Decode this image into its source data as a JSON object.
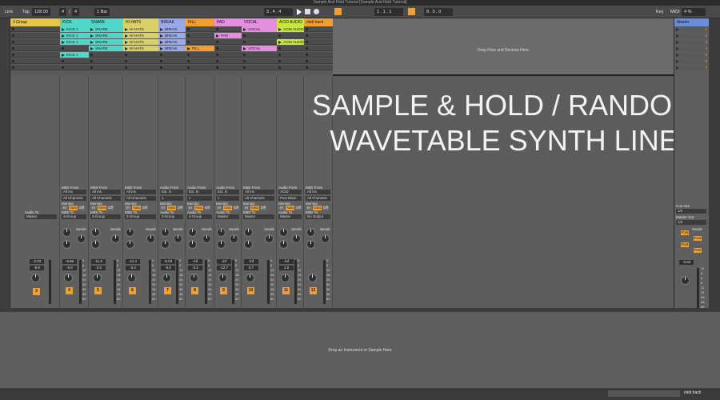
{
  "window_title": "Sample And Hold Tutorial  [Sample And Hold Tutorial]",
  "transport": {
    "link": "Link",
    "tap": "Tap",
    "tempo": "128.00",
    "sig_num": "4",
    "sig_den": "4",
    "quantize": "1 Bar",
    "position": "3 .  4 .  4",
    "loop_start": "1 .  1 .  1",
    "loop_len": "8 .  0 .  0",
    "key": "Key",
    "midi": "MIDI",
    "cpu": "4 %"
  },
  "tracks": [
    {
      "name": "3 Group",
      "color": "#e6c64a",
      "clips": []
    },
    {
      "name": "KICK",
      "color": "#52d6c8",
      "clips": [
        "KICK 1",
        "KICK 1",
        "KICK 1",
        "",
        "KICK 1"
      ]
    },
    {
      "name": "SNARE",
      "color": "#52d6c8",
      "clips": [
        "SNARE",
        "SNARE",
        "SNARE",
        "SNARE",
        ""
      ]
    },
    {
      "name": "HI HATS",
      "color": "#d9d06a",
      "clips": [
        "HI HATS",
        "HI HATS",
        "HI HATS",
        "HI HATS",
        ""
      ]
    },
    {
      "name": "BREAK",
      "color": "#9aa8e8",
      "clips": [
        "BREAK",
        "BREAK",
        "BREAK",
        "BREAK",
        ""
      ]
    },
    {
      "name": "FILL",
      "color": "#f0a030",
      "clips": [
        "",
        "",
        "",
        "FILL",
        ""
      ]
    },
    {
      "name": "PAD",
      "color": "#e48ee0",
      "clips": [
        "",
        "PAD",
        "",
        "",
        ""
      ]
    },
    {
      "name": "VOCAL",
      "color": "#e48ee0",
      "clips": [
        "VOCAL",
        "",
        "",
        "VOCAL",
        ""
      ]
    },
    {
      "name": "ACID AUDIO",
      "color": "#c8e640",
      "clips": [
        "ACID AUDIO",
        "",
        "ACID AUDIO",
        "",
        ""
      ]
    },
    {
      "name": "midi track",
      "color": "#f0a030",
      "clips": []
    }
  ],
  "drop_files": "Drop Files and Devices Here",
  "master": {
    "name": "Master",
    "scenes": [
      "1",
      "2",
      "3",
      "4",
      "5",
      "6",
      "7"
    ],
    "cue_out_label": "Cue Out",
    "cue_out_value": "1/2",
    "master_out_label": "Master Out",
    "master_out_value": "1/2",
    "sends": "Sends",
    "post": "Post",
    "volume": "-3.33",
    "scale": [
      "12",
      "6",
      "0",
      "6",
      "12",
      "24",
      "36",
      "48",
      "60"
    ]
  },
  "mixer": {
    "audio_to_label": "Audio To",
    "audio_to_value": "Master",
    "sends": "Sends",
    "monitor": "Monitor",
    "mon_in": "In",
    "mon_auto": "Auto",
    "mon_off": "Off",
    "scale": [
      "0",
      "6",
      "12",
      "18",
      "24",
      "30",
      "36",
      "48",
      "60"
    ],
    "columns": [
      {
        "from_label": "MIDI From",
        "from": "All Ins",
        "chan": "All Channels",
        "to_label": "MIDI To",
        "to": "3-Group",
        "vol": "-8.86",
        "pan": "-5.0",
        "num": "4"
      },
      {
        "from_label": "MIDI From",
        "from": "All Ins",
        "chan": "All Channels",
        "to_label": "MIDI To",
        "to": "3-Group",
        "vol": "-11.0",
        "pan": "-3.5",
        "num": "5"
      },
      {
        "from_label": "MIDI From",
        "from": "All Ins",
        "chan": "All Channels",
        "to_label": "MIDI To",
        "to": "3-Group",
        "vol": "-11.4",
        "pan": "-3.4",
        "num": "6"
      },
      {
        "from_label": "Audio From",
        "from": "Ext. In",
        "chan": "1",
        "to_label": "Audio To",
        "to": "3-Group",
        "vol": "-9.03",
        "pan": "-9.0",
        "num": "7"
      },
      {
        "from_label": "Audio From",
        "from": "Ext. In",
        "chan": "1",
        "to_label": "Audio To",
        "to": "3-Group",
        "vol": "-inf",
        "pan": "-4.2",
        "num": "8"
      },
      {
        "from_label": "Audio From",
        "from": "Ext. In",
        "chan": "1",
        "to_label": "Audio To",
        "to": "Master",
        "vol": "-inf",
        "pan": "-12.7",
        "num": "9"
      },
      {
        "from_label": "MIDI From",
        "from": "All Ins",
        "chan": "All Channels",
        "to_label": "MIDI To",
        "to": "Master",
        "vol": "-inf",
        "pan": "0.7",
        "num": "10"
      },
      {
        "from_label": "Audio From",
        "from": "ACID",
        "chan": "Post Mixer",
        "to_label": "Audio To",
        "to": "Master",
        "vol": "-inf",
        "pan": "1.0",
        "num": "11"
      },
      {
        "from_label": "MIDI From",
        "from": "All Ins",
        "chan": "All Channels",
        "to_label": "MIDI To",
        "to": "No Output",
        "vol": "",
        "pan": "",
        "num": "12"
      }
    ],
    "group_vol": "-3.23",
    "group_pan": "-8.8",
    "group_num": "3",
    "group_scale": [
      "0",
      "6",
      "12",
      "18",
      "24",
      "30",
      "36",
      "48",
      "60"
    ]
  },
  "overlay": {
    "line1": "SAMPLE & HOLD / RANDOM",
    "line2": "WAVETABLE SYNTH LINE"
  },
  "device": {
    "drop_instrument": "Drop an Instrument or Sample Here"
  },
  "status": {
    "track": "midi track"
  }
}
